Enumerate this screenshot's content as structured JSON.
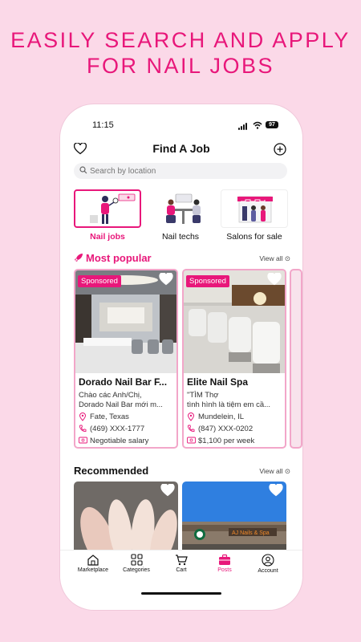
{
  "headline": {
    "line1": "EASILY SEARCH AND APPLY",
    "line2": "FOR NAIL JOBS"
  },
  "status_bar": {
    "time": "11:15",
    "battery": "97"
  },
  "header": {
    "title": "Find A Job"
  },
  "search": {
    "placeholder": "Search by location"
  },
  "categories": [
    {
      "label": "Nail jobs",
      "active": true
    },
    {
      "label": "Nail techs",
      "active": false
    },
    {
      "label": "Salons for sale",
      "active": false
    }
  ],
  "most_popular": {
    "title": "Most popular",
    "view_all": "View all",
    "cards": [
      {
        "badge": "Sponsored",
        "name": "Dorado Nail Bar F...",
        "desc_line1": "Chào các Anh/Chị,",
        "desc_line2": "Dorado Nail Bar mới m...",
        "location": "Fate, Texas",
        "phone": "(469) XXX-1777",
        "salary": "Negotiable salary"
      },
      {
        "badge": "Sponsored",
        "name": "Elite Nail Spa",
        "desc_line1": "\"TÌM Thợ",
        "desc_line2": "tình hình là tiệm em cầ...",
        "location": "Mundelein, IL",
        "phone": "(847) XXX-0202",
        "salary": "$1,100 per week"
      }
    ]
  },
  "recommended": {
    "title": "Recommended",
    "view_all": "View all",
    "sign_text": "AJ Nails & Spa"
  },
  "bottom_nav": [
    {
      "label": "Marketplace",
      "icon": "home-icon",
      "active": false
    },
    {
      "label": "Categories",
      "icon": "grid-icon",
      "active": false
    },
    {
      "label": "Cart",
      "icon": "cart-icon",
      "active": false
    },
    {
      "label": "Posts",
      "icon": "briefcase-icon",
      "active": true
    },
    {
      "label": "Account",
      "icon": "user-icon",
      "active": false
    }
  ],
  "colors": {
    "accent": "#e8177a",
    "background": "#fbd9e8",
    "card_border": "#f2a6c9"
  }
}
